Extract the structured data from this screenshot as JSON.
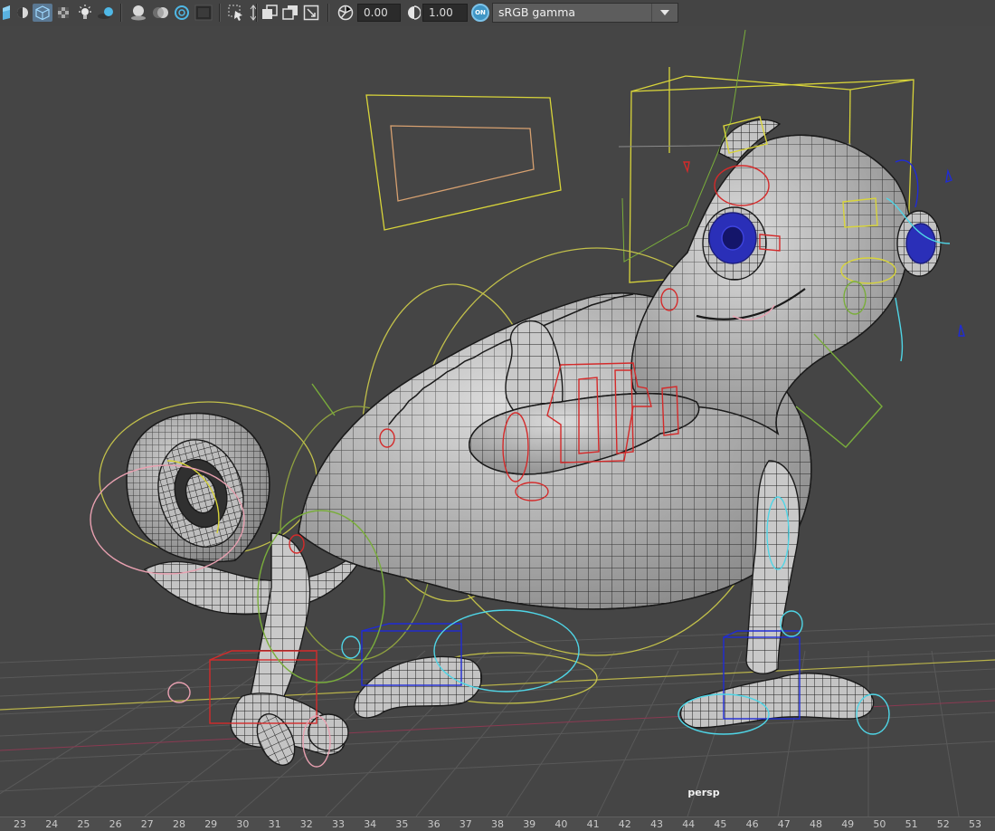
{
  "toolbar": {
    "icons": [
      "display-mode-icon",
      "isolate-icon",
      "wireframe-on-shaded-icon",
      "xray-icon",
      "lights-icon",
      "shadows-icon",
      "ambient-occlusion-icon",
      "motion-blur-icon",
      "depth-of-field-icon",
      "resolution-gate-icon",
      "select-camera-icon",
      "film-gate-icon",
      "safe-action-icon",
      "grid-icon",
      "exposure-icon",
      "gamma-icon"
    ],
    "exposure_value": "0.00",
    "gamma_value": "1.00",
    "color_management_badge": "ON",
    "view_transform": "sRGB gamma"
  },
  "viewport": {
    "camera_label": "persp"
  },
  "timeline": {
    "frames": [
      "23",
      "24",
      "25",
      "26",
      "27",
      "28",
      "29",
      "30",
      "31",
      "32",
      "33",
      "34",
      "35",
      "36",
      "37",
      "38",
      "39",
      "40",
      "41",
      "42",
      "43",
      "44",
      "45",
      "46",
      "47",
      "48",
      "49",
      "50",
      "51",
      "52",
      "53"
    ]
  },
  "colors": {
    "viewport_bg": "#454545",
    "grid": "#555555",
    "selection_yellow": "#d8d43a",
    "ik_red": "#d42a2a",
    "fk_blue": "#1f2bd6",
    "cyan_control": "#4fd5e6",
    "green_control": "#6fa23a"
  }
}
